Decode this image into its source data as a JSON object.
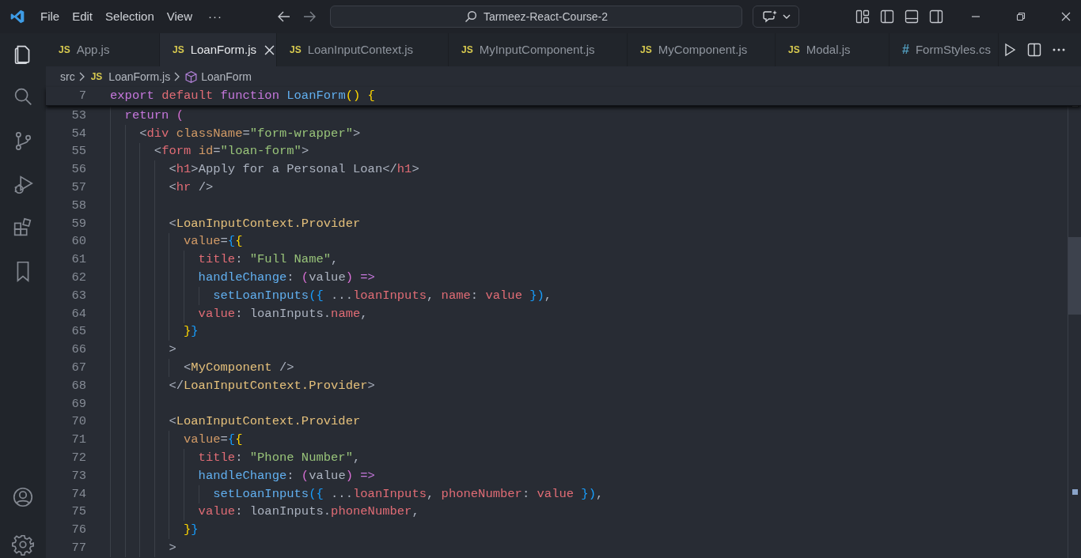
{
  "menu": [
    "File",
    "Edit",
    "Selection",
    "View",
    "···"
  ],
  "search": {
    "value": "Tarmeez-React-Course-2"
  },
  "activity_bar": {
    "top": [
      {
        "kind": "files",
        "selected": true
      },
      {
        "kind": "search",
        "selected": false
      },
      {
        "kind": "source-control",
        "selected": false
      },
      {
        "kind": "debug",
        "selected": false
      },
      {
        "kind": "extensions",
        "selected": false
      },
      {
        "kind": "bookmark",
        "selected": false
      }
    ],
    "bottom": [
      {
        "kind": "account",
        "selected": false
      },
      {
        "kind": "settings",
        "selected": false
      }
    ]
  },
  "tabs": [
    {
      "label": "App.js",
      "kind": "js",
      "badge": "JS",
      "selected": false
    },
    {
      "label": "LoanForm.js",
      "kind": "js",
      "badge": "JS",
      "selected": true
    },
    {
      "label": "LoanInputContext.js",
      "kind": "js",
      "badge": "JS",
      "selected": false
    },
    {
      "label": "MyInputComponent.js",
      "kind": "js",
      "badge": "JS",
      "selected": false
    },
    {
      "label": "MyComponent.js",
      "kind": "js",
      "badge": "JS",
      "selected": false
    },
    {
      "label": "Modal.js",
      "kind": "js",
      "badge": "JS",
      "selected": false
    },
    {
      "label": "FormStyles.cs",
      "kind": "css",
      "badge": "#",
      "selected": false
    }
  ],
  "breadcrumb": [
    {
      "kind": "folder",
      "label": "src"
    },
    {
      "kind": "file",
      "badge": "JS",
      "label": "LoanForm.js"
    },
    {
      "kind": "symbol",
      "label": "LoanForm"
    }
  ],
  "sticky_line": {
    "number": "7",
    "tokens": [
      {
        "kind": "kw",
        "t": "export "
      },
      {
        "kind": "kw2",
        "t": "default "
      },
      {
        "kind": "kw",
        "t": "function "
      },
      {
        "kind": "fn",
        "t": "LoanForm"
      },
      {
        "kind": "br1",
        "t": "() {"
      }
    ]
  },
  "lines": [
    {
      "number": "53",
      "tokens": [
        {
          "kind": "kw",
          "t": "  return "
        },
        {
          "kind": "br2",
          "t": "("
        }
      ]
    },
    {
      "number": "54",
      "tokens": [
        {
          "kind": "punct",
          "t": "    <"
        },
        {
          "kind": "tag",
          "t": "div "
        },
        {
          "kind": "attr",
          "t": "className"
        },
        {
          "kind": "punct",
          "t": "="
        },
        {
          "kind": "str",
          "t": "\"form-wrapper\""
        },
        {
          "kind": "punct",
          "t": ">"
        }
      ]
    },
    {
      "number": "55",
      "tokens": [
        {
          "kind": "punct",
          "t": "      <"
        },
        {
          "kind": "tag",
          "t": "form "
        },
        {
          "kind": "attr",
          "t": "id"
        },
        {
          "kind": "punct",
          "t": "="
        },
        {
          "kind": "str",
          "t": "\"loan-form\""
        },
        {
          "kind": "punct",
          "t": ">"
        }
      ]
    },
    {
      "number": "56",
      "tokens": [
        {
          "kind": "punct",
          "t": "        <"
        },
        {
          "kind": "tag",
          "t": "h1"
        },
        {
          "kind": "punct",
          "t": ">"
        },
        {
          "kind": "plain",
          "t": "Apply for a Personal Loan"
        },
        {
          "kind": "punct",
          "t": "</"
        },
        {
          "kind": "tag",
          "t": "h1"
        },
        {
          "kind": "punct",
          "t": ">"
        }
      ]
    },
    {
      "number": "57",
      "tokens": [
        {
          "kind": "punct",
          "t": "        <"
        },
        {
          "kind": "tag",
          "t": "hr "
        },
        {
          "kind": "punct",
          "t": "/>"
        }
      ]
    },
    {
      "number": "58"
    },
    {
      "number": "59",
      "tokens": [
        {
          "kind": "punct",
          "t": "        <"
        },
        {
          "kind": "comp",
          "t": "LoanInputContext.Provider"
        }
      ]
    },
    {
      "number": "60",
      "tokens": [
        {
          "kind": "attr",
          "t": "          value"
        },
        {
          "kind": "punct",
          "t": "="
        },
        {
          "kind": "br3",
          "t": "{"
        },
        {
          "kind": "br1",
          "t": "{"
        }
      ]
    },
    {
      "number": "61",
      "tokens": [
        {
          "kind": "prop",
          "t": "            title"
        },
        {
          "kind": "punct",
          "t": ": "
        },
        {
          "kind": "str",
          "t": "\"Full Name\""
        },
        {
          "kind": "punct",
          "t": ","
        }
      ]
    },
    {
      "number": "62",
      "tokens": [
        {
          "kind": "fn",
          "t": "            handleChange"
        },
        {
          "kind": "punct",
          "t": ": "
        },
        {
          "kind": "br2",
          "t": "("
        },
        {
          "kind": "plain",
          "t": "value"
        },
        {
          "kind": "br2",
          "t": ")"
        },
        {
          "kind": "kw",
          "t": " =>"
        }
      ]
    },
    {
      "number": "63",
      "tokens": [
        {
          "kind": "fn",
          "t": "              setLoanInputs"
        },
        {
          "kind": "br3",
          "t": "({"
        },
        {
          "kind": "plain",
          "t": " ..."
        },
        {
          "kind": "prop",
          "t": "loanInputs"
        },
        {
          "kind": "punct",
          "t": ", "
        },
        {
          "kind": "prop",
          "t": "name"
        },
        {
          "kind": "punct",
          "t": ": "
        },
        {
          "kind": "prop",
          "t": "value"
        },
        {
          "kind": "br3",
          "t": " })"
        },
        {
          "kind": "punct",
          "t": ","
        }
      ]
    },
    {
      "number": "64",
      "tokens": [
        {
          "kind": "prop",
          "t": "            value"
        },
        {
          "kind": "punct",
          "t": ": "
        },
        {
          "kind": "plain",
          "t": "loanInputs."
        },
        {
          "kind": "prop",
          "t": "name"
        },
        {
          "kind": "punct",
          "t": ","
        }
      ]
    },
    {
      "number": "65",
      "tokens": [
        {
          "kind": "br1",
          "t": "          }"
        },
        {
          "kind": "br3",
          "t": "}"
        }
      ]
    },
    {
      "number": "66",
      "tokens": [
        {
          "kind": "punct",
          "t": "        >"
        }
      ]
    },
    {
      "number": "67",
      "tokens": [
        {
          "kind": "punct",
          "t": "          <"
        },
        {
          "kind": "comp",
          "t": "MyComponent "
        },
        {
          "kind": "punct",
          "t": "/>"
        }
      ]
    },
    {
      "number": "68",
      "tokens": [
        {
          "kind": "punct",
          "t": "        </"
        },
        {
          "kind": "comp",
          "t": "LoanInputContext.Provider"
        },
        {
          "kind": "punct",
          "t": ">"
        }
      ]
    },
    {
      "number": "69"
    },
    {
      "number": "70",
      "tokens": [
        {
          "kind": "punct",
          "t": "        <"
        },
        {
          "kind": "comp",
          "t": "LoanInputContext.Provider"
        }
      ]
    },
    {
      "number": "71",
      "tokens": [
        {
          "kind": "attr",
          "t": "          value"
        },
        {
          "kind": "punct",
          "t": "="
        },
        {
          "kind": "br3",
          "t": "{"
        },
        {
          "kind": "br1",
          "t": "{"
        }
      ]
    },
    {
      "number": "72",
      "tokens": [
        {
          "kind": "prop",
          "t": "            title"
        },
        {
          "kind": "punct",
          "t": ": "
        },
        {
          "kind": "str",
          "t": "\"Phone Number\""
        },
        {
          "kind": "punct",
          "t": ","
        }
      ]
    },
    {
      "number": "73",
      "tokens": [
        {
          "kind": "fn",
          "t": "            handleChange"
        },
        {
          "kind": "punct",
          "t": ": "
        },
        {
          "kind": "br2",
          "t": "("
        },
        {
          "kind": "plain",
          "t": "value"
        },
        {
          "kind": "br2",
          "t": ")"
        },
        {
          "kind": "kw",
          "t": " =>"
        }
      ]
    },
    {
      "number": "74",
      "tokens": [
        {
          "kind": "fn",
          "t": "              setLoanInputs"
        },
        {
          "kind": "br3",
          "t": "({"
        },
        {
          "kind": "plain",
          "t": " ..."
        },
        {
          "kind": "prop",
          "t": "loanInputs"
        },
        {
          "kind": "punct",
          "t": ", "
        },
        {
          "kind": "prop",
          "t": "phoneNumber"
        },
        {
          "kind": "punct",
          "t": ": "
        },
        {
          "kind": "prop",
          "t": "value"
        },
        {
          "kind": "br3",
          "t": " })"
        },
        {
          "kind": "punct",
          "t": ","
        }
      ]
    },
    {
      "number": "75",
      "tokens": [
        {
          "kind": "prop",
          "t": "            value"
        },
        {
          "kind": "punct",
          "t": ": "
        },
        {
          "kind": "plain",
          "t": "loanInputs."
        },
        {
          "kind": "prop",
          "t": "phoneNumber"
        },
        {
          "kind": "punct",
          "t": ","
        }
      ]
    },
    {
      "number": "76",
      "tokens": [
        {
          "kind": "br1",
          "t": "          }"
        },
        {
          "kind": "br3",
          "t": "}"
        }
      ]
    },
    {
      "number": "77",
      "tokens": [
        {
          "kind": "punct",
          "t": "        >"
        }
      ]
    }
  ]
}
